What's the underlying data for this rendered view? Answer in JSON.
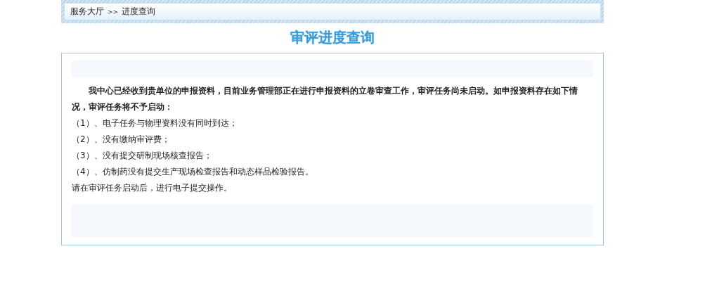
{
  "breadcrumb": {
    "items": [
      "服务大厅",
      "进度查询"
    ],
    "separator": ">>"
  },
  "title": "审评进度查询",
  "notice": {
    "intro": "我中心已经收到贵单位的申报资料，目前业务管理部正在进行申报资料的立卷审查工作，审评任务尚未启动。如申报资料存在如下情况，审评任务将不予启动：",
    "conditions": [
      "（1）、电子任务与物理资料没有同时到达；",
      "（2）、没有缴纳审评费；",
      "（3）、没有提交研制现场核查报告；",
      "（4）、仿制药没有提交生产现场检查报告和动态样品检验报告。"
    ],
    "closing": "请在审评任务启动后，进行电子提交操作。"
  }
}
